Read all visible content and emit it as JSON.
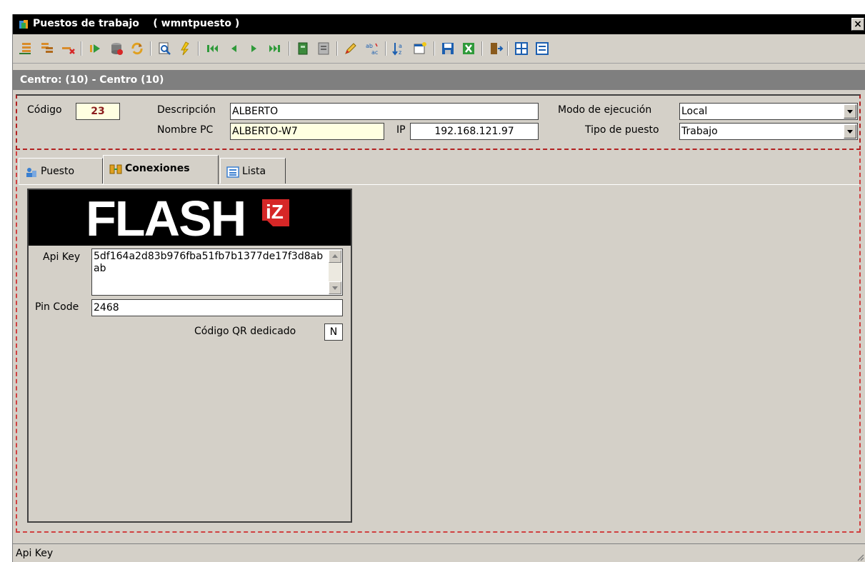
{
  "window": {
    "title": "Puestos de trabajo    ( wmntpuesto )",
    "close_label": "×"
  },
  "toolbar": {
    "icons": [
      "insert-record-icon",
      "copy-record-icon",
      "delete-record-icon",
      "execute-icon",
      "database-icon",
      "refresh-icon",
      "preview-icon",
      "filter-icon",
      "first-record-icon",
      "prev-record-icon",
      "next-record-icon",
      "last-record-icon",
      "book-icon",
      "report-icon",
      "edit-icon",
      "replace-icon",
      "sort-icon",
      "new-window-icon",
      "save-icon",
      "excel-icon",
      "exit-icon",
      "grid-icon",
      "form-icon"
    ]
  },
  "centro": {
    "label": "Centro: (10) - Centro (10)"
  },
  "form": {
    "codigo_label": "Código",
    "codigo_value": "23",
    "descripcion_label": "Descripción",
    "descripcion_value": "ALBERTO",
    "nombre_pc_label": "Nombre PC",
    "nombre_pc_value": "ALBERTO-W7",
    "ip_label": "IP",
    "ip_value": "192.168.121.97",
    "modo_label": "Modo de ejecución",
    "modo_value": "Local",
    "tipo_label": "Tipo de puesto",
    "tipo_value": "Trabajo"
  },
  "tabs": [
    {
      "label": "Puesto"
    },
    {
      "label": "Conexiones"
    },
    {
      "label": "Lista"
    }
  ],
  "flashiz": {
    "logo_text": "FLASH",
    "badge_text": "iZ",
    "api_key_label": "Api Key",
    "api_key_value": "5df164a2d83b976fba51fb7b1377de17f3d8abab",
    "pin_label": "Pin Code",
    "pin_value": "2468",
    "qr_label": "Código QR dedicado",
    "qr_value": "N"
  },
  "status": {
    "text": "Api Key"
  },
  "colors": {
    "accent_red": "#d62727",
    "title_bg": "#000000",
    "window_bg": "#d4d0c8"
  }
}
